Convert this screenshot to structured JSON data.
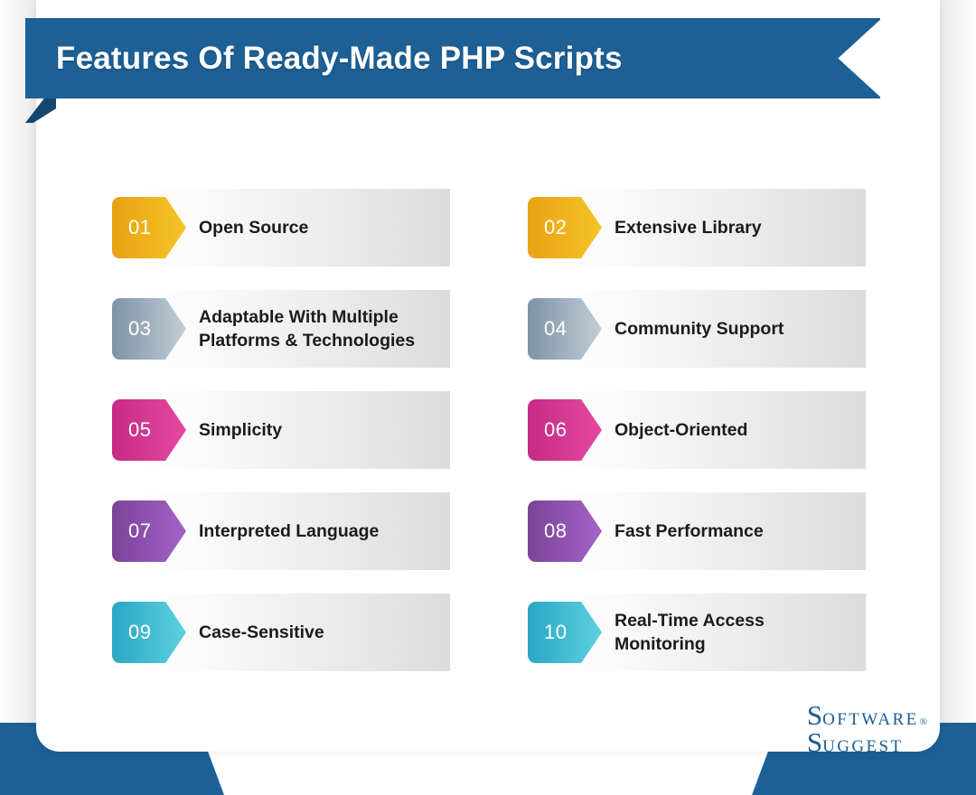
{
  "header": {
    "title": "Features Of Ready-Made PHP Scripts",
    "ribbon_color": "#1d6096",
    "fold_color": "#14476f"
  },
  "features": [
    {
      "number": "01",
      "label_line1": "Open Source",
      "label_line2": "",
      "color_from": "#e8a211",
      "color_to": "#f6c428"
    },
    {
      "number": "02",
      "label_line1": "Extensive Library",
      "label_line2": "",
      "color_from": "#e8a211",
      "color_to": "#f6c428"
    },
    {
      "number": "03",
      "label_line1": "Adaptable With Multiple",
      "label_line2": "Platforms & Technologies",
      "color_from": "#7d93a6",
      "color_to": "#c3cdd6"
    },
    {
      "number": "04",
      "label_line1": "Community Support",
      "label_line2": "",
      "color_from": "#7d93a6",
      "color_to": "#c3cdd6"
    },
    {
      "number": "05",
      "label_line1": "Simplicity",
      "label_line2": "",
      "color_from": "#c62a86",
      "color_to": "#e5499f"
    },
    {
      "number": "06",
      "label_line1": "Object-Oriented",
      "label_line2": "",
      "color_from": "#c62a86",
      "color_to": "#e5499f"
    },
    {
      "number": "07",
      "label_line1": "Interpreted Language",
      "label_line2": "",
      "color_from": "#7a4397",
      "color_to": "#a463c9"
    },
    {
      "number": "08",
      "label_line1": "Fast Performance",
      "label_line2": "",
      "color_from": "#7a4397",
      "color_to": "#a463c9"
    },
    {
      "number": "09",
      "label_line1": "Case-Sensitive",
      "label_line2": "",
      "color_from": "#2aa7c4",
      "color_to": "#5ed0e0"
    },
    {
      "number": "10",
      "label_line1": "Real-Time Access",
      "label_line2": "Monitoring",
      "color_from": "#2aa7c4",
      "color_to": "#5ed0e0"
    }
  ],
  "logo": {
    "line1_initial": "S",
    "line1_rest": "oftware",
    "registered": "®",
    "line2_initial": "S",
    "line2_rest": "uggest",
    "color": "#1d5c92"
  }
}
